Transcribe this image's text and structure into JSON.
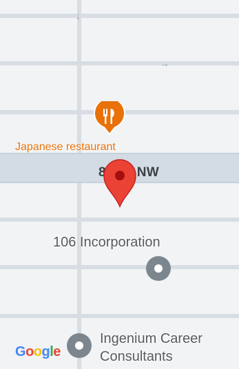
{
  "map": {
    "road_label": "8 Ave NW",
    "pois": [
      {
        "name": "Japanese restaurant",
        "category": "restaurant",
        "icon": "fork-knife-icon",
        "color": "#e8710a"
      },
      {
        "name": "106 Incorporation",
        "category": "business",
        "icon": "place-dot-icon",
        "color": "#7b868f"
      },
      {
        "name": "Ingenium Career Consultants",
        "line1": "Ingenium Career",
        "line2": "Consultants",
        "category": "business",
        "icon": "place-dot-icon",
        "color": "#7b868f"
      }
    ],
    "selected_pin": {
      "icon": "red-location-pin-icon",
      "color": "#ea4335"
    },
    "attribution": {
      "logo_letters": [
        "G",
        "o",
        "o",
        "g",
        "l",
        "e"
      ],
      "logo_colors": [
        "#4285f4",
        "#ea4335",
        "#fbbc05",
        "#4285f4",
        "#34a853",
        "#ea4335"
      ]
    },
    "road_arrows": [
      "↓",
      "→"
    ]
  }
}
